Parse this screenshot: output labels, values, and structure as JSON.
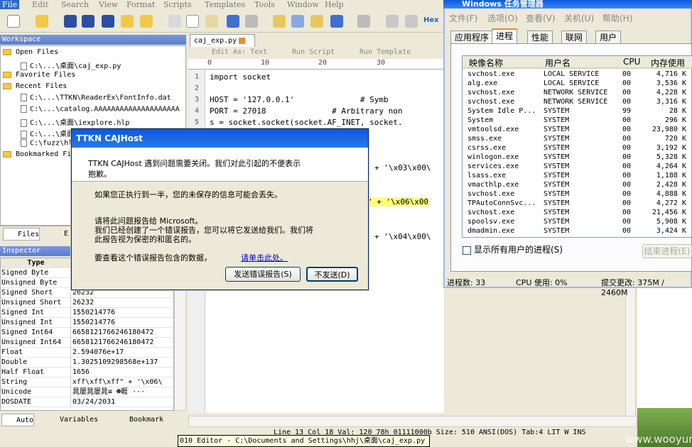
{
  "menu": {
    "items": [
      "File",
      "Edit",
      "Search",
      "View",
      "Format",
      "Scripts",
      "Templates",
      "Tools",
      "Window",
      "Help"
    ]
  },
  "toolbar": {
    "hex_label": "Hex"
  },
  "workspace": {
    "title": "Workspace",
    "open_files_label": "Open Files",
    "open_files": [
      "C:\\...\\桌面\\caj_exp.py"
    ],
    "favorite_label": "Favorite Files",
    "recent_label": "Recent Files",
    "recent": [
      "C:\\...\\TTKN\\ReaderEx\\FontInfo.dat",
      "C:\\...\\catalog.AAAAAAAAAAAAAAAAAAAA",
      "C:\\...\\桌面\\iexplore.hlp",
      "C:\\...\\桌面",
      "C:\\fuzz\\hl"
    ],
    "bookmarked_label": "Bookmarked Fi",
    "tabs": [
      "Files",
      "E"
    ]
  },
  "inspector": {
    "title": "Inspector",
    "header_type": "Type",
    "rows": [
      {
        "k": "Signed Byte",
        "v": ""
      },
      {
        "k": "Unsigned Byte",
        "v": ""
      },
      {
        "k": "Signed Short",
        "v": "26232"
      },
      {
        "k": "Unsigned Short",
        "v": "26232"
      },
      {
        "k": "Signed Int",
        "v": "1550214776"
      },
      {
        "k": "Unsigned Int",
        "v": "1550214776"
      },
      {
        "k": "Signed Int64",
        "v": "6658121766246180472"
      },
      {
        "k": "Unsigned Int64",
        "v": "6658121766246180472"
      },
      {
        "k": "Float",
        "v": "2.594076e+17"
      },
      {
        "k": "Double",
        "v": "1.3025109298568e+137"
      },
      {
        "k": "Half Float",
        "v": "1656"
      },
      {
        "k": "String",
        "v": "xff\\xff\\xff\" + '\\x06\\"
      },
      {
        "k": "Unicode",
        "v": "晁屡晁屡晁≡  ☻睚 ···"
      },
      {
        "k": "DOSDATE",
        "v": "03/24/2031"
      }
    ],
    "bottom_tabs": [
      "Auto",
      "Variables",
      "Bookmark"
    ]
  },
  "editor": {
    "file_tab": "caj_exp.py",
    "toolbar_items": [
      "Edit As: Text",
      "Run Script",
      "Run Template"
    ],
    "ruler": [
      "0",
      "10",
      "20",
      "30"
    ],
    "line_numbers": [
      "1",
      "2",
      "3",
      "4",
      "5"
    ],
    "lines": [
      "import socket",
      "",
      "HOST = '127.0.0.1'              # Symb",
      "PORT = 27018              # Arbitrary non",
      "s = socket.socket(socket.AF_INET, socket."
    ],
    "frag1": "+ '\\x03\\x00\\",
    "frag2": "\" + '\\x06\\x00",
    "frag3": "+ '\\x04\\x00\\",
    "status": "Line 13  Col 18  Val: 120 78h 01111000b  Size: 510    ANSI(DOS)  Tab:4  LIT  W  INS"
  },
  "taskbar_tip": "010 Editor - C:\\Documents and Settings\\hhj\\桌面\\caj_exp.py",
  "watermark": "www.wooyun.org",
  "taskmgr": {
    "title": "Windows 任务管理器",
    "menu": [
      "文件(F)",
      "选项(O)",
      "查看(V)",
      "关机(U)",
      "帮助(H)"
    ],
    "tabs": [
      "应用程序",
      "进程",
      "性能",
      "联网",
      "用户"
    ],
    "cols": [
      "映像名称",
      "用户名",
      "CPU",
      "内存使用"
    ],
    "procs": [
      [
        "svchost.exe",
        "LOCAL SERVICE",
        "00",
        "4,716 K"
      ],
      [
        "alg.exe",
        "LOCAL SERVICE",
        "00",
        "3,536 K"
      ],
      [
        "svchost.exe",
        "NETWORK SERVICE",
        "00",
        "4,228 K"
      ],
      [
        "svchost.exe",
        "NETWORK SERVICE",
        "00",
        "3,316 K"
      ],
      [
        "System Idle P...",
        "SYSTEM",
        "99",
        "28 K"
      ],
      [
        "System",
        "SYSTEM",
        "00",
        "296 K"
      ],
      [
        "vmtoolsd.exe",
        "SYSTEM",
        "00",
        "23,980 K"
      ],
      [
        "smss.exe",
        "SYSTEM",
        "00",
        "720 K"
      ],
      [
        "csrss.exe",
        "SYSTEM",
        "00",
        "3,192 K"
      ],
      [
        "winlogon.exe",
        "SYSTEM",
        "00",
        "5,328 K"
      ],
      [
        "services.exe",
        "SYSTEM",
        "00",
        "4,264 K"
      ],
      [
        "lsass.exe",
        "SYSTEM",
        "00",
        "1,188 K"
      ],
      [
        "vmacthlp.exe",
        "SYSTEM",
        "00",
        "2,428 K"
      ],
      [
        "svchost.exe",
        "SYSTEM",
        "00",
        "4,888 K"
      ],
      [
        "TPAutoConnSvc...",
        "SYSTEM",
        "00",
        "4,272 K"
      ],
      [
        "svchost.exe",
        "SYSTEM",
        "00",
        "21,456 K"
      ],
      [
        "spoolsv.exe",
        "SYSTEM",
        "00",
        "5,908 K"
      ],
      [
        "dmadmin.exe",
        "SYSTEM",
        "00",
        "3,424 K"
      ]
    ],
    "show_all": "显示所有用户的进程(S)",
    "end_process": "结束进程(E)",
    "status": [
      "进程数: 33",
      "CPU 使用: 0%",
      "提交更改: 375M / 2460M"
    ]
  },
  "dialog": {
    "title": "TTKN CAJHost",
    "msg1": "TTKN CAJHost 遇到问题需要关闭。我们对此引起的不便表示",
    "msg2": "抱歉。",
    "msg3": "如果您正执行到一半，您的未保存的信息可能会丢失。",
    "msg4": "请将此问题报告给 Microsoft。",
    "msg5": "我们已经创建了一个错误报告，您可以将它发送给我们。我们将",
    "msg6": "此报告视为保密的和匿名的。",
    "msg7": "要查看这个错误报告包含的数据，",
    "link": "请单击此处。",
    "send": "发送错误报告(S)",
    "dont_send": "不发送(D)"
  }
}
